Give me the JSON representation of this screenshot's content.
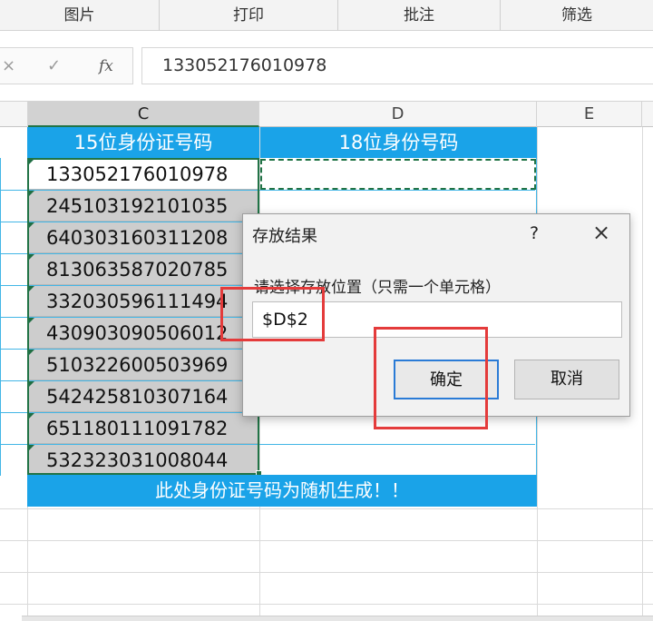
{
  "ribbon": {
    "tabs": [
      "图片",
      "打印",
      "批注",
      "筛选"
    ]
  },
  "formula_bar": {
    "cancel_glyph": "×",
    "confirm_glyph": "✓",
    "fx_label": "fx",
    "value": "133052176010978"
  },
  "columns": [
    "C",
    "D",
    "E"
  ],
  "sheet": {
    "header_c": "15位身份证号码",
    "header_d": "18位身份号码",
    "ids": [
      "133052176010978",
      "245103192101035",
      "640303160311208",
      "813063587020785",
      "332030596111494",
      "430903090506012",
      "510322600503969",
      "542425810307164",
      "651180111091782",
      "532323031008044"
    ],
    "footer_note": "此处身份证号码为随机生成！！"
  },
  "dialog": {
    "title": "存放结果",
    "help": "?",
    "close": "×",
    "prompt": "请选择存放位置（只需一个单元格）",
    "input_value": "$D$2",
    "ok_label": "确定",
    "cancel_label": "取消"
  },
  "annotation_color": "#e43b3b",
  "accent_color": "#1aa3e8"
}
